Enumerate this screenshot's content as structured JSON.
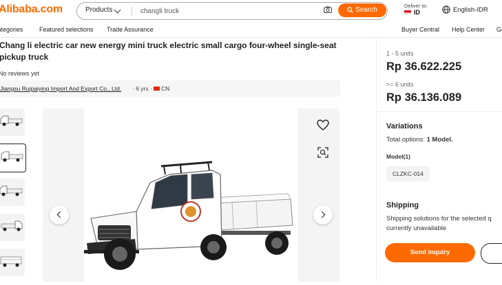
{
  "header": {
    "logo": "Alibaba.com",
    "search": {
      "category": "Products",
      "query": "changli truck",
      "button": "Search"
    },
    "deliver_to": {
      "label": "Deliver to:",
      "country": "ID"
    },
    "language": "English-IDR"
  },
  "nav": {
    "items": [
      "Categories",
      "Featured selections",
      "Trade Assurance",
      "Buyer Central",
      "Help Center",
      "Get"
    ]
  },
  "product": {
    "title": "Chang li electric car new energy mini truck electric small cargo four-wheel single-seat pickup truck",
    "reviews": "No reviews yet",
    "supplier": {
      "name": "Jiangsu Ruipaiying Import And Export Co., Ltd.",
      "years": "· 6 yrs ·",
      "country": "CN"
    }
  },
  "pricing": {
    "tiers": [
      {
        "range": "1 - 5 units",
        "price": "Rp 36.622.225"
      },
      {
        "range": ">= 6 units",
        "price": "Rp 36.136.089"
      }
    ]
  },
  "variations": {
    "heading": "Variations",
    "total_label": "Total options:",
    "total_value": "1 Model.",
    "model_label": "Model(1)",
    "model_option": "CLZKC-014"
  },
  "shipping": {
    "heading": "Shipping",
    "line1": "Shipping solutions for the selected q",
    "line2": "currently unavailable"
  },
  "actions": {
    "send_inquiry": "Send inquiry"
  },
  "colors": {
    "brand": "#ff6a00",
    "text": "#222222"
  },
  "icons": [
    "camera-icon",
    "search-icon",
    "globe-icon",
    "heart-icon",
    "scan-icon",
    "chevron-left-icon",
    "chevron-right-icon"
  ]
}
